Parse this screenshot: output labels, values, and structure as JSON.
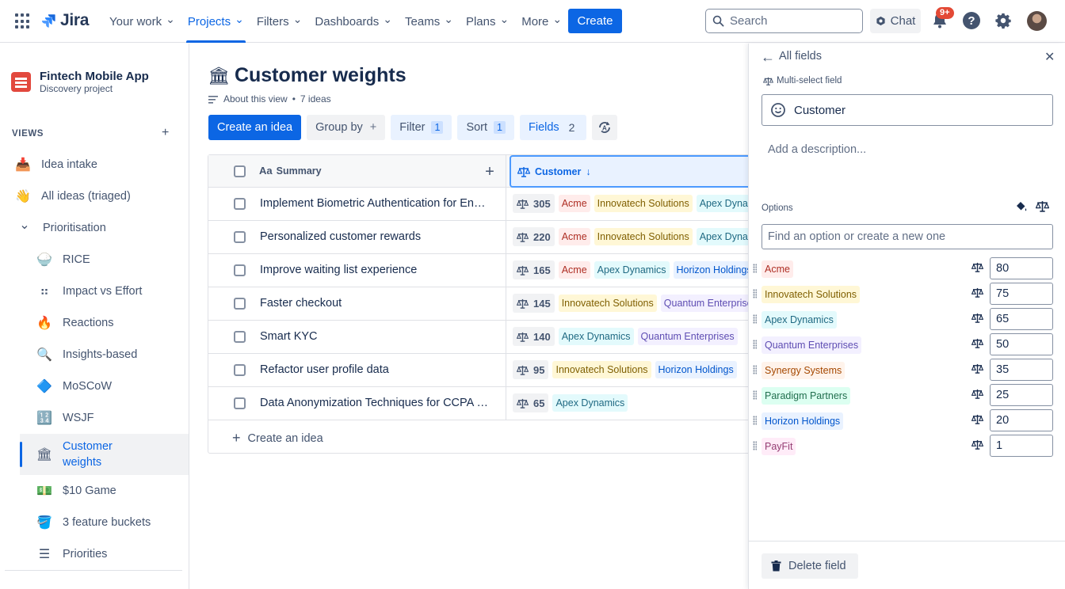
{
  "nav": {
    "logo_text": "Jira",
    "items": [
      {
        "label": "Your work",
        "active": false
      },
      {
        "label": "Projects",
        "active": true
      },
      {
        "label": "Filters",
        "active": false
      },
      {
        "label": "Dashboards",
        "active": false
      },
      {
        "label": "Teams",
        "active": false
      },
      {
        "label": "Plans",
        "active": false
      },
      {
        "label": "More",
        "active": false
      }
    ],
    "create_label": "Create",
    "search_placeholder": "Search",
    "chat_label": "Chat",
    "notifications_badge": "9+",
    "help_glyph": "?",
    "accent": "#0c66e4"
  },
  "sidebar": {
    "project_name": "Fintech Mobile App",
    "project_type": "Discovery project",
    "views_heading": "VIEWS",
    "views_add": "+",
    "items": [
      {
        "label": "Idea intake",
        "icon": "inbox-tray-icon",
        "glyph": "📥",
        "level": 0
      },
      {
        "label": "All ideas (triaged)",
        "icon": "waving-hand-icon",
        "glyph": "👋",
        "level": 0
      },
      {
        "label": "Prioritisation",
        "icon": "chevron-down-icon",
        "glyph": "⌄",
        "level": 0,
        "folder": true
      },
      {
        "label": "RICE",
        "icon": "rice-bowl-icon",
        "glyph": "🍚",
        "level": 1
      },
      {
        "label": "Impact vs Effort",
        "icon": "matrix-icon",
        "glyph": "⠶",
        "level": 1
      },
      {
        "label": "Reactions",
        "icon": "fire-icon",
        "glyph": "🔥",
        "level": 1
      },
      {
        "label": "Insights-based",
        "icon": "magnifier-icon",
        "glyph": "🔍",
        "level": 1
      },
      {
        "label": "MoSCoW",
        "icon": "moscow-icon",
        "glyph": "🔷",
        "level": 1
      },
      {
        "label": "WSJF",
        "icon": "numbers-icon",
        "glyph": "🔢",
        "level": 1
      },
      {
        "label": "Customer weights",
        "icon": "bank-icon",
        "glyph": "🏛",
        "level": 1,
        "active": true
      },
      {
        "label": "$10 Game",
        "icon": "dollar-bill-icon",
        "glyph": "💵",
        "level": 1
      },
      {
        "label": "3 feature buckets",
        "icon": "bucket-icon",
        "glyph": "🪣",
        "level": 1
      },
      {
        "label": "Priorities",
        "icon": "list-icon",
        "glyph": "☰",
        "level": 1
      }
    ]
  },
  "main": {
    "title": "Customer weights",
    "about_label": "About this view",
    "ideas_count": "7 ideas",
    "toolbar": {
      "create_label": "Create an idea",
      "group_label": "Group by",
      "group_add": "+",
      "filter_label": "Filter",
      "filter_count": "1",
      "sort_label": "Sort",
      "sort_count": "1",
      "fields_label": "Fields",
      "fields_count": "2"
    },
    "table": {
      "summary_header": "Summary",
      "summary_header_icon": "Aa",
      "add_column": "+",
      "customer_header": "Customer",
      "sort_arrow": "↓",
      "rows": [
        {
          "summary": "Implement Biometric Authentication for Enhanced Security",
          "score": "305",
          "tags": [
            "Acme",
            "Innovatech Solutions",
            "Apex Dynamics"
          ]
        },
        {
          "summary": "Personalized customer rewards",
          "score": "220",
          "tags": [
            "Acme",
            "Innovatech Solutions",
            "Apex Dynamics"
          ]
        },
        {
          "summary": "Improve waiting list experience",
          "score": "165",
          "tags": [
            "Acme",
            "Apex Dynamics",
            "Horizon Holdings"
          ]
        },
        {
          "summary": "Faster checkout",
          "score": "145",
          "tags": [
            "Innovatech Solutions",
            "Quantum Enterprises"
          ]
        },
        {
          "summary": "Smart KYC",
          "score": "140",
          "tags": [
            "Apex Dynamics",
            "Quantum Enterprises"
          ]
        },
        {
          "summary": "Refactor user profile data",
          "score": "95",
          "tags": [
            "Innovatech Solutions",
            "Horizon Holdings"
          ]
        },
        {
          "summary": "Data Anonymization Techniques for CCPA Compliance",
          "score": "65",
          "tags": [
            "Apex Dynamics"
          ]
        }
      ],
      "create_row_label": "Create an idea"
    }
  },
  "panel": {
    "back_label": "All fields",
    "field_type": "Multi-select field",
    "field_name": "Customer",
    "description_placeholder": "Add a description...",
    "options_heading": "Options",
    "find_placeholder": "Find an option or create a new one",
    "options": [
      {
        "label": "Acme",
        "weight": "80"
      },
      {
        "label": "Innovatech Solutions",
        "weight": "75"
      },
      {
        "label": "Apex Dynamics",
        "weight": "65"
      },
      {
        "label": "Quantum Enterprises",
        "weight": "50"
      },
      {
        "label": "Synergy Systems",
        "weight": "35"
      },
      {
        "label": "Paradigm Partners",
        "weight": "25"
      },
      {
        "label": "Horizon Holdings",
        "weight": "20"
      },
      {
        "label": "PayFit",
        "weight": "1"
      }
    ],
    "delete_label": "Delete field"
  },
  "tag_colors": {
    "Acme": {
      "bg": "#ffeceb",
      "fg": "#ae2e24"
    },
    "Innovatech Solutions": {
      "bg": "#fff7d6",
      "fg": "#7f5f01"
    },
    "Apex Dynamics": {
      "bg": "#e3fafc",
      "fg": "#206a83"
    },
    "Horizon Holdings": {
      "bg": "#e9f2ff",
      "fg": "#0055cc"
    },
    "Quantum Enterprises": {
      "bg": "#f3f0ff",
      "fg": "#5e4db2"
    },
    "Synergy Systems": {
      "bg": "#fff3eb",
      "fg": "#a54800"
    },
    "Paradigm Partners": {
      "bg": "#dcfff1",
      "fg": "#216e4e"
    },
    "PayFit": {
      "bg": "#ffecf8",
      "fg": "#943d73"
    }
  }
}
